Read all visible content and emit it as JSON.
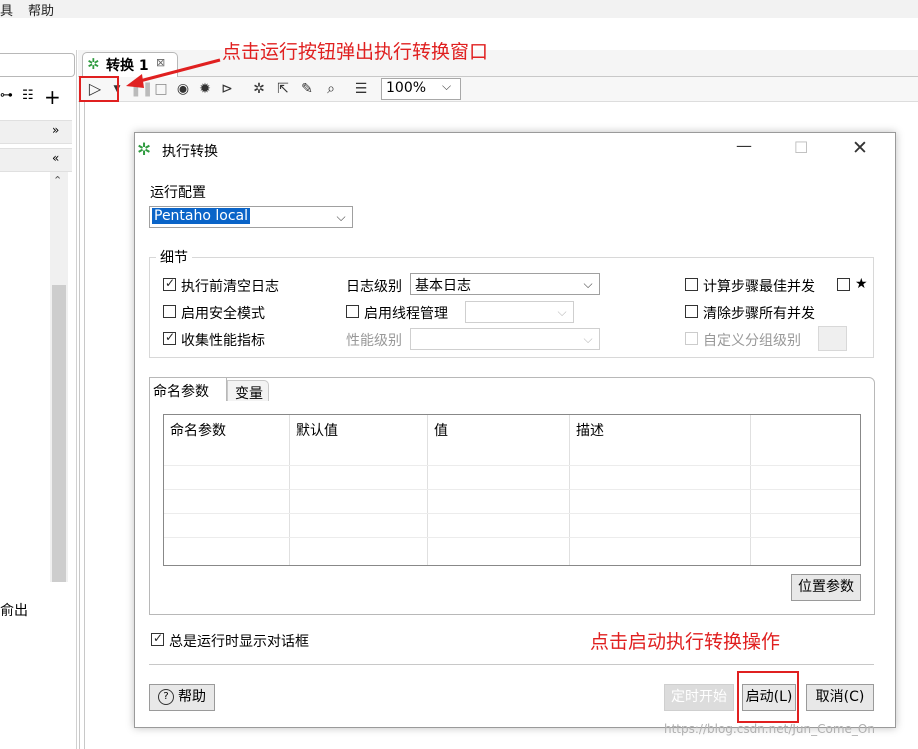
{
  "menu": {
    "items": [
      "具",
      "帮助"
    ]
  },
  "left_panel": {
    "partial_label": "俞出"
  },
  "tab": {
    "label": "转换 1",
    "close_glyph": "⊠"
  },
  "toolbar": {
    "zoom": "100%"
  },
  "annotations": {
    "top": "点击运行按钮弹出执行转换窗口",
    "bottom": "点击启动执行转换操作"
  },
  "dialog": {
    "title": "执行转换",
    "run_config_label": "运行配置",
    "run_config_value": "Pentaho local",
    "details_label": "细节",
    "options": {
      "clear_log": {
        "label": "执行前清空日志",
        "checked": true
      },
      "safe_mode": {
        "label": "启用安全模式",
        "checked": false
      },
      "gather_metrics": {
        "label": "收集性能指标",
        "checked": true
      },
      "log_level_label": "日志级别",
      "log_level_value": "基本日志",
      "thread_mgmt": {
        "label": "启用线程管理",
        "checked": false
      },
      "perf_level_label": "性能级别",
      "calc_concurrency": {
        "label": "计算步骤最佳并发",
        "checked": false
      },
      "star_label": "★",
      "clear_concurrency": {
        "label": "清除步骤所有并发",
        "checked": false
      },
      "custom_group": {
        "label": "自定义分组级别",
        "checked": false
      }
    },
    "tabs": [
      "命名参数",
      "变量"
    ],
    "table_headers": [
      "命名参数",
      "默认值",
      "值",
      "描述"
    ],
    "position_params_button": "位置参数",
    "always_show": {
      "label": "总是运行时显示对话框",
      "checked": true
    },
    "help_button": "帮助",
    "schedule_button": "定时开始",
    "start_button": "启动(L)",
    "cancel_button": "取消(C)"
  },
  "watermark": "https://blog.csdn.net/Jun_Come_On"
}
